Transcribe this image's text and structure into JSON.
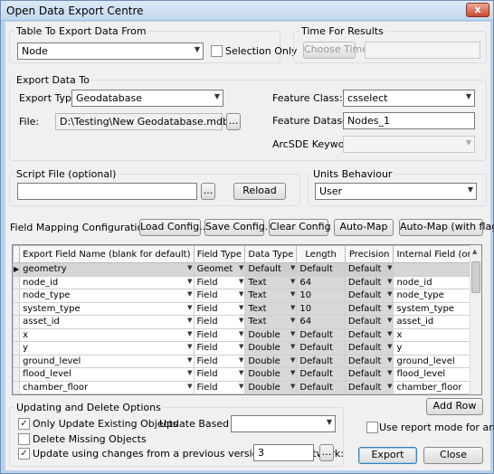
{
  "window": {
    "title": "Open Data Export Centre",
    "close_glyph": "x"
  },
  "table_export": {
    "group_label": "Table To Export Data From",
    "table": "Node",
    "selection_only_label": "Selection Only"
  },
  "time_results": {
    "group_label": "Time For Results",
    "button": "Choose Time"
  },
  "export_to": {
    "group_label": "Export Data To",
    "export_type_label": "Export Type:",
    "export_type": "Geodatabase",
    "file_label": "File:",
    "file_value": "D:\\Testing\\New Geodatabase.mdb",
    "browse": "...",
    "feature_class_label": "Feature Class:",
    "feature_class": "csselect",
    "feature_dataset_label": "Feature Dataset:",
    "feature_dataset": "Nodes_1",
    "arcsde_label": "ArcSDE Keyword:"
  },
  "script": {
    "group_label": "Script File (optional)",
    "browse": "...",
    "reload": "Reload"
  },
  "units": {
    "group_label": "Units Behaviour",
    "value": "User"
  },
  "field_mapping": {
    "label": "Field Mapping Configuration:",
    "buttons": [
      "Load Config...",
      "Save Config...",
      "Clear Config",
      "Auto-Map",
      "Auto-Map (with flags)"
    ]
  },
  "grid": {
    "columns": [
      "Export Field Name (blank for default)",
      "Field Type",
      "Data Type",
      "Length",
      "Precision",
      "Internal Field (or other data)"
    ],
    "rows": [
      [
        "geometry",
        "Geomet",
        "Default",
        "Default",
        "Default",
        ""
      ],
      [
        "node_id",
        "Field",
        "Text",
        "64",
        "Default",
        "node_id"
      ],
      [
        "node_type",
        "Field",
        "Text",
        "10",
        "Default",
        "node_type"
      ],
      [
        "system_type",
        "Field",
        "Text",
        "10",
        "Default",
        "system_type"
      ],
      [
        "asset_id",
        "Field",
        "Text",
        "64",
        "Default",
        "asset_id"
      ],
      [
        "x",
        "Field",
        "Double",
        "Default",
        "Default",
        "x"
      ],
      [
        "y",
        "Field",
        "Double",
        "Default",
        "Default",
        "y"
      ],
      [
        "ground_level",
        "Field",
        "Double",
        "Default",
        "Default",
        "ground_level"
      ],
      [
        "flood_level",
        "Field",
        "Double",
        "Default",
        "Default",
        "flood_level"
      ],
      [
        "chamber_floor",
        "Field",
        "Double",
        "Default",
        "Default",
        "chamber_floor"
      ]
    ]
  },
  "updating": {
    "group_label": "Updating and Delete Options",
    "only_update_label": "Only Update Existing Objects",
    "delete_missing_label": "Delete Missing Objects",
    "update_changes_label": "Update using changes from a previous version of the network:",
    "version_value": "3",
    "browse": "...",
    "update_based_on_label": "Update Based On:"
  },
  "side": {
    "add_row": "Add Row",
    "report_mode_label": "Use report mode for arrays",
    "export": "Export",
    "close": "Close"
  }
}
